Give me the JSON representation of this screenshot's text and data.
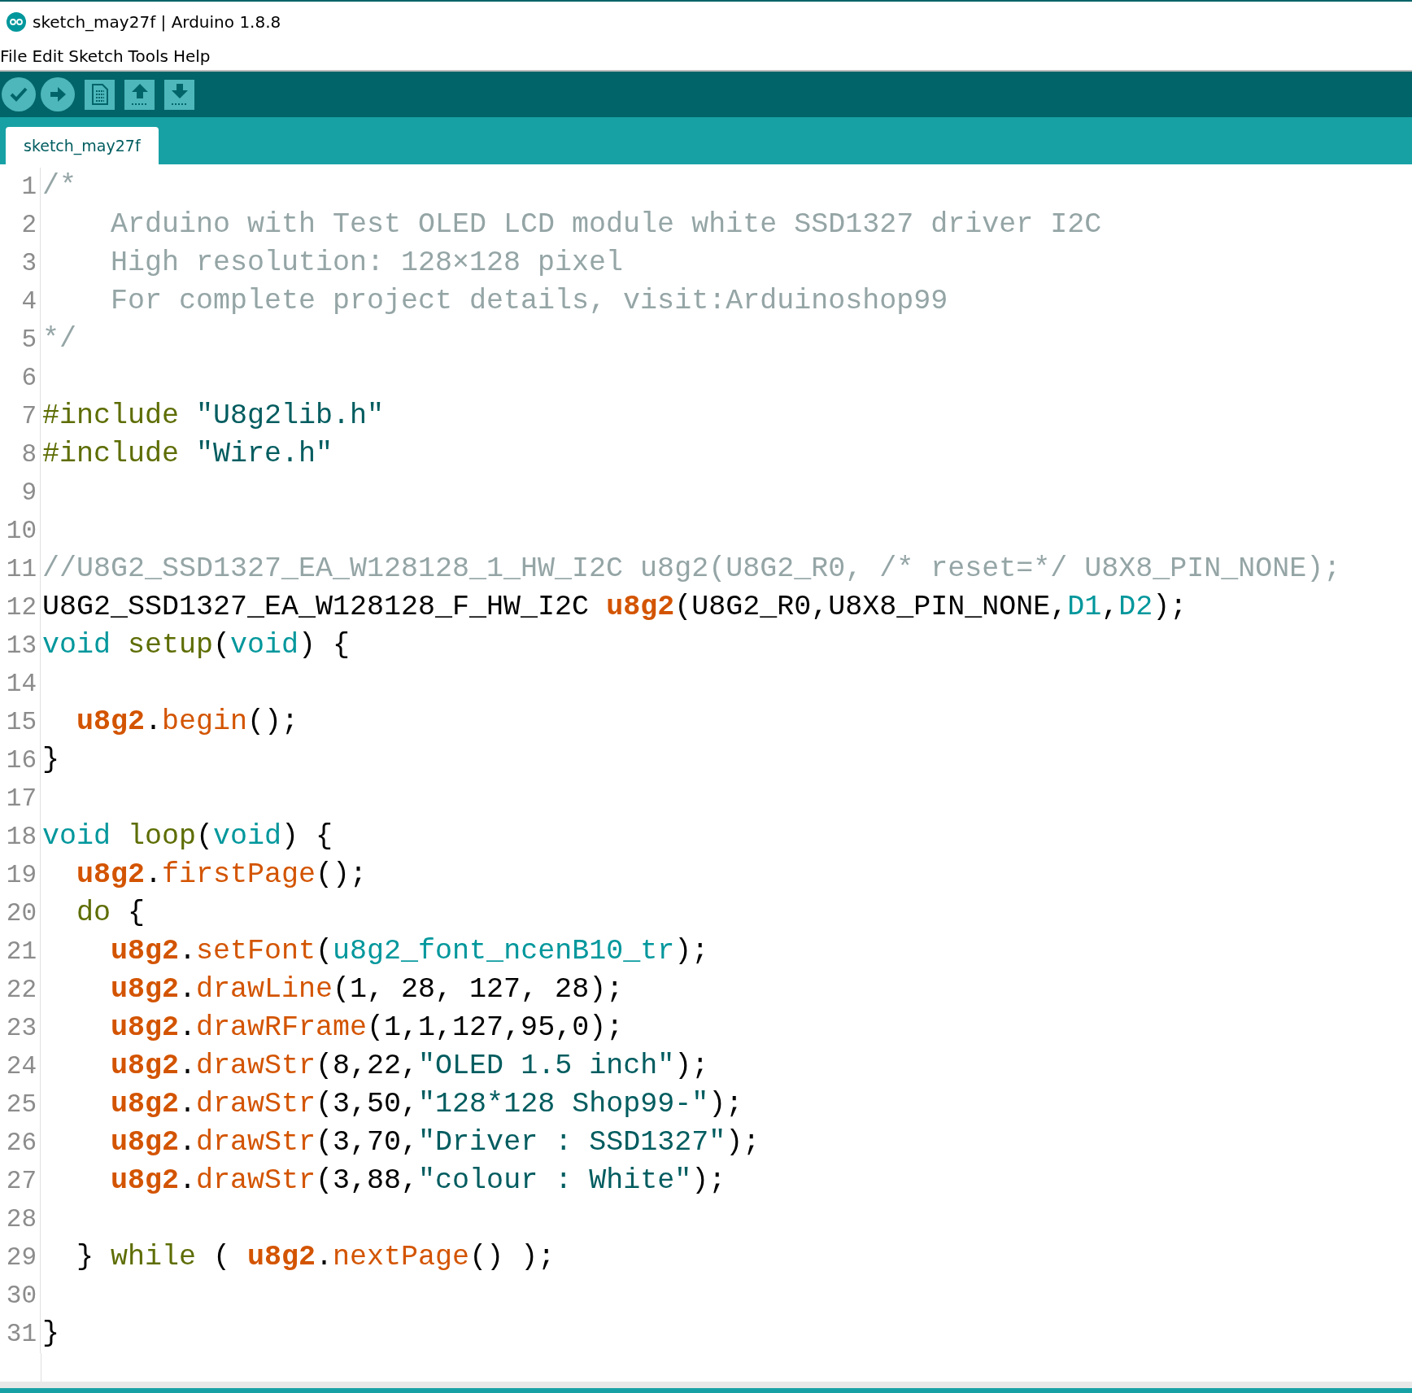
{
  "window": {
    "title": "sketch_may27f | Arduino 1.8.8"
  },
  "menu": [
    "File",
    "Edit",
    "Sketch",
    "Tools",
    "Help"
  ],
  "toolbar": [
    {
      "kind": "verify"
    },
    {
      "kind": "upload"
    },
    {
      "kind": "new"
    },
    {
      "kind": "open"
    },
    {
      "kind": "save"
    }
  ],
  "tabs": [
    {
      "label": "sketch_may27f",
      "selected": true
    }
  ],
  "editor": {
    "lines": [
      {
        "number": "1",
        "tokens": [
          {
            "kind": "comment",
            "text": "/*"
          }
        ]
      },
      {
        "number": "2",
        "tokens": [
          {
            "kind": "comment",
            "text": "    Arduino with Test OLED LCD module white SSD1327 driver I2C"
          }
        ]
      },
      {
        "number": "3",
        "tokens": [
          {
            "kind": "comment",
            "text": "    High resolution: 128×128 pixel"
          }
        ]
      },
      {
        "number": "4",
        "tokens": [
          {
            "kind": "comment",
            "text": "    For complete project details, visit:Arduinoshop99"
          }
        ]
      },
      {
        "number": "5",
        "tokens": [
          {
            "kind": "comment",
            "text": "*/"
          }
        ]
      },
      {
        "number": "6"
      },
      {
        "number": "7",
        "tokens": [
          {
            "kind": "fn",
            "text": "#include "
          },
          {
            "kind": "string",
            "text": "\"U8g2lib.h\""
          }
        ]
      },
      {
        "number": "8",
        "tokens": [
          {
            "kind": "fn",
            "text": "#include "
          },
          {
            "kind": "string",
            "text": "\"Wire.h\""
          }
        ]
      },
      {
        "number": "9"
      },
      {
        "number": "10"
      },
      {
        "number": "11",
        "tokens": [
          {
            "kind": "comment",
            "text": "//U8G2_SSD1327_EA_W128128_1_HW_I2C u8g2(U8G2_R0, /* reset=*/ U8X8_PIN_NONE);"
          }
        ]
      },
      {
        "number": "12",
        "tokens": [
          {
            "kind": "plain",
            "text": "U8G2_SSD1327_EA_W128128_F_HW_I2C "
          },
          {
            "kind": "object",
            "text": "u8g2"
          },
          {
            "kind": "plain",
            "text": "(U8G2_R0,U8X8_PIN_NONE,"
          },
          {
            "kind": "keyword",
            "text": "D1"
          },
          {
            "kind": "plain",
            "text": ","
          },
          {
            "kind": "keyword",
            "text": "D2"
          },
          {
            "kind": "plain",
            "text": ");"
          }
        ]
      },
      {
        "number": "13",
        "tokens": [
          {
            "kind": "keyword",
            "text": "void "
          },
          {
            "kind": "fn",
            "text": "setup"
          },
          {
            "kind": "plain",
            "text": "("
          },
          {
            "kind": "keyword",
            "text": "void"
          },
          {
            "kind": "plain",
            "text": ") {"
          }
        ]
      },
      {
        "number": "14"
      },
      {
        "number": "15",
        "tokens": [
          {
            "kind": "object",
            "text": "  u8g2"
          },
          {
            "kind": "plain",
            "text": "."
          },
          {
            "kind": "method",
            "text": "begin"
          },
          {
            "kind": "plain",
            "text": "();"
          }
        ]
      },
      {
        "number": "16",
        "tokens": [
          {
            "kind": "plain",
            "text": "}"
          }
        ]
      },
      {
        "number": "17"
      },
      {
        "number": "18",
        "tokens": [
          {
            "kind": "keyword",
            "text": "void "
          },
          {
            "kind": "fn",
            "text": "loop"
          },
          {
            "kind": "plain",
            "text": "("
          },
          {
            "kind": "keyword",
            "text": "void"
          },
          {
            "kind": "plain",
            "text": ") {"
          }
        ]
      },
      {
        "number": "19",
        "tokens": [
          {
            "kind": "object",
            "text": "  u8g2"
          },
          {
            "kind": "plain",
            "text": "."
          },
          {
            "kind": "method",
            "text": "firstPage"
          },
          {
            "kind": "plain",
            "text": "();"
          }
        ]
      },
      {
        "number": "20",
        "tokens": [
          {
            "kind": "fn",
            "text": "  do"
          },
          {
            "kind": "plain",
            "text": " {"
          }
        ]
      },
      {
        "number": "21",
        "tokens": [
          {
            "kind": "object",
            "text": "    u8g2"
          },
          {
            "kind": "plain",
            "text": "."
          },
          {
            "kind": "method",
            "text": "setFont"
          },
          {
            "kind": "plain",
            "text": "("
          },
          {
            "kind": "keyword",
            "text": "u8g2_font_ncenB10_tr"
          },
          {
            "kind": "plain",
            "text": ");"
          }
        ]
      },
      {
        "number": "22",
        "tokens": [
          {
            "kind": "object",
            "text": "    u8g2"
          },
          {
            "kind": "plain",
            "text": "."
          },
          {
            "kind": "method",
            "text": "drawLine"
          },
          {
            "kind": "plain",
            "text": "(1, 28, 127, 28);"
          }
        ]
      },
      {
        "number": "23",
        "tokens": [
          {
            "kind": "object",
            "text": "    u8g2"
          },
          {
            "kind": "plain",
            "text": "."
          },
          {
            "kind": "method",
            "text": "drawRFrame"
          },
          {
            "kind": "plain",
            "text": "(1,1,127,95,0);"
          }
        ]
      },
      {
        "number": "24",
        "tokens": [
          {
            "kind": "object",
            "text": "    u8g2"
          },
          {
            "kind": "plain",
            "text": "."
          },
          {
            "kind": "method",
            "text": "drawStr"
          },
          {
            "kind": "plain",
            "text": "(8,22,"
          },
          {
            "kind": "string",
            "text": "\"OLED 1.5 inch\""
          },
          {
            "kind": "plain",
            "text": ");"
          }
        ]
      },
      {
        "number": "25",
        "tokens": [
          {
            "kind": "object",
            "text": "    u8g2"
          },
          {
            "kind": "plain",
            "text": "."
          },
          {
            "kind": "method",
            "text": "drawStr"
          },
          {
            "kind": "plain",
            "text": "(3,50,"
          },
          {
            "kind": "string",
            "text": "\"128*128 Shop99-\""
          },
          {
            "kind": "plain",
            "text": ");"
          }
        ]
      },
      {
        "number": "26",
        "tokens": [
          {
            "kind": "object",
            "text": "    u8g2"
          },
          {
            "kind": "plain",
            "text": "."
          },
          {
            "kind": "method",
            "text": "drawStr"
          },
          {
            "kind": "plain",
            "text": "(3,70,"
          },
          {
            "kind": "string",
            "text": "\"Driver : SSD1327\""
          },
          {
            "kind": "plain",
            "text": ");"
          }
        ]
      },
      {
        "number": "27",
        "tokens": [
          {
            "kind": "object",
            "text": "    u8g2"
          },
          {
            "kind": "plain",
            "text": "."
          },
          {
            "kind": "method",
            "text": "drawStr"
          },
          {
            "kind": "plain",
            "text": "(3,88,"
          },
          {
            "kind": "string",
            "text": "\"colour : White\""
          },
          {
            "kind": "plain",
            "text": ");"
          }
        ]
      },
      {
        "number": "28"
      },
      {
        "number": "29",
        "tokens": [
          {
            "kind": "plain",
            "text": "  } "
          },
          {
            "kind": "fn",
            "text": "while"
          },
          {
            "kind": "plain",
            "text": " ( "
          },
          {
            "kind": "object",
            "text": "u8g2"
          },
          {
            "kind": "plain",
            "text": "."
          },
          {
            "kind": "method",
            "text": "nextPage"
          },
          {
            "kind": "plain",
            "text": "() );"
          }
        ]
      },
      {
        "number": "30"
      },
      {
        "number": "31",
        "tokens": [
          {
            "kind": "plain",
            "text": "}"
          }
        ]
      }
    ]
  }
}
